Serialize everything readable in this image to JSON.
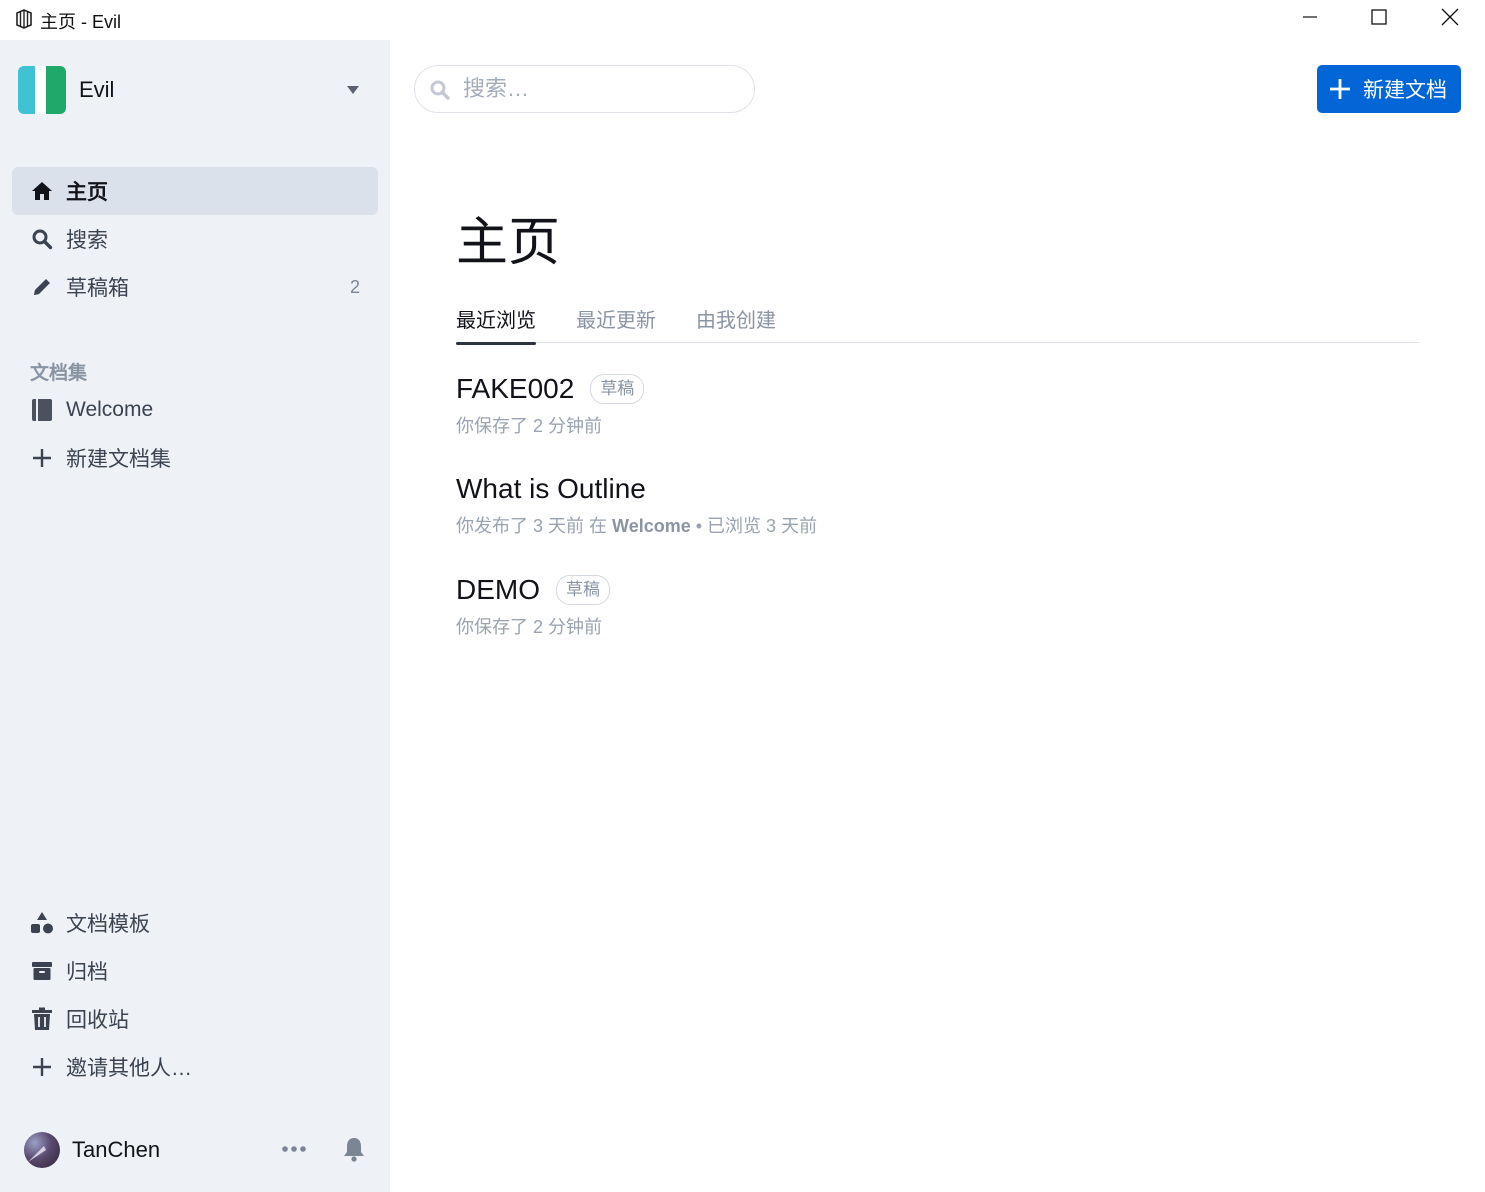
{
  "window": {
    "title": "主页 - Evil"
  },
  "team": {
    "name": "Evil"
  },
  "nav": {
    "home": "主页",
    "search": "搜索",
    "drafts": "草稿箱",
    "drafts_count": "2"
  },
  "collections": {
    "section_title": "文档集",
    "items": [
      {
        "label": "Welcome"
      }
    ],
    "new_label": "新建文档集"
  },
  "bottom_nav": {
    "templates": "文档模板",
    "archive": "归档",
    "trash": "回收站",
    "invite": "邀请其他人…"
  },
  "user": {
    "name": "TanChen"
  },
  "search": {
    "placeholder": "搜索…"
  },
  "toolbar": {
    "new_doc_label": "新建文档"
  },
  "page": {
    "title": "主页"
  },
  "tabs": [
    {
      "label": "最近浏览",
      "active": true
    },
    {
      "label": "最近更新",
      "active": false
    },
    {
      "label": "由我创建",
      "active": false
    }
  ],
  "documents": [
    {
      "title": "FAKE002",
      "badge": "草稿",
      "meta": "你保存了 2 分钟前"
    },
    {
      "title": "What is Outline",
      "meta_prefix": "你发布了 3 天前 在",
      "meta_collection": "Welcome",
      "meta_suffix": "• 已浏览 3 天前"
    },
    {
      "title": "DEMO",
      "badge": "草稿",
      "meta": "你保存了 2 分钟前"
    }
  ],
  "colors": {
    "sidebar_bg": "#eef2f6",
    "active_nav_bg": "#dae1ea",
    "primary_button": "#0366d6",
    "logo_teal": "#3fc3d4",
    "logo_green": "#1fa86a"
  }
}
